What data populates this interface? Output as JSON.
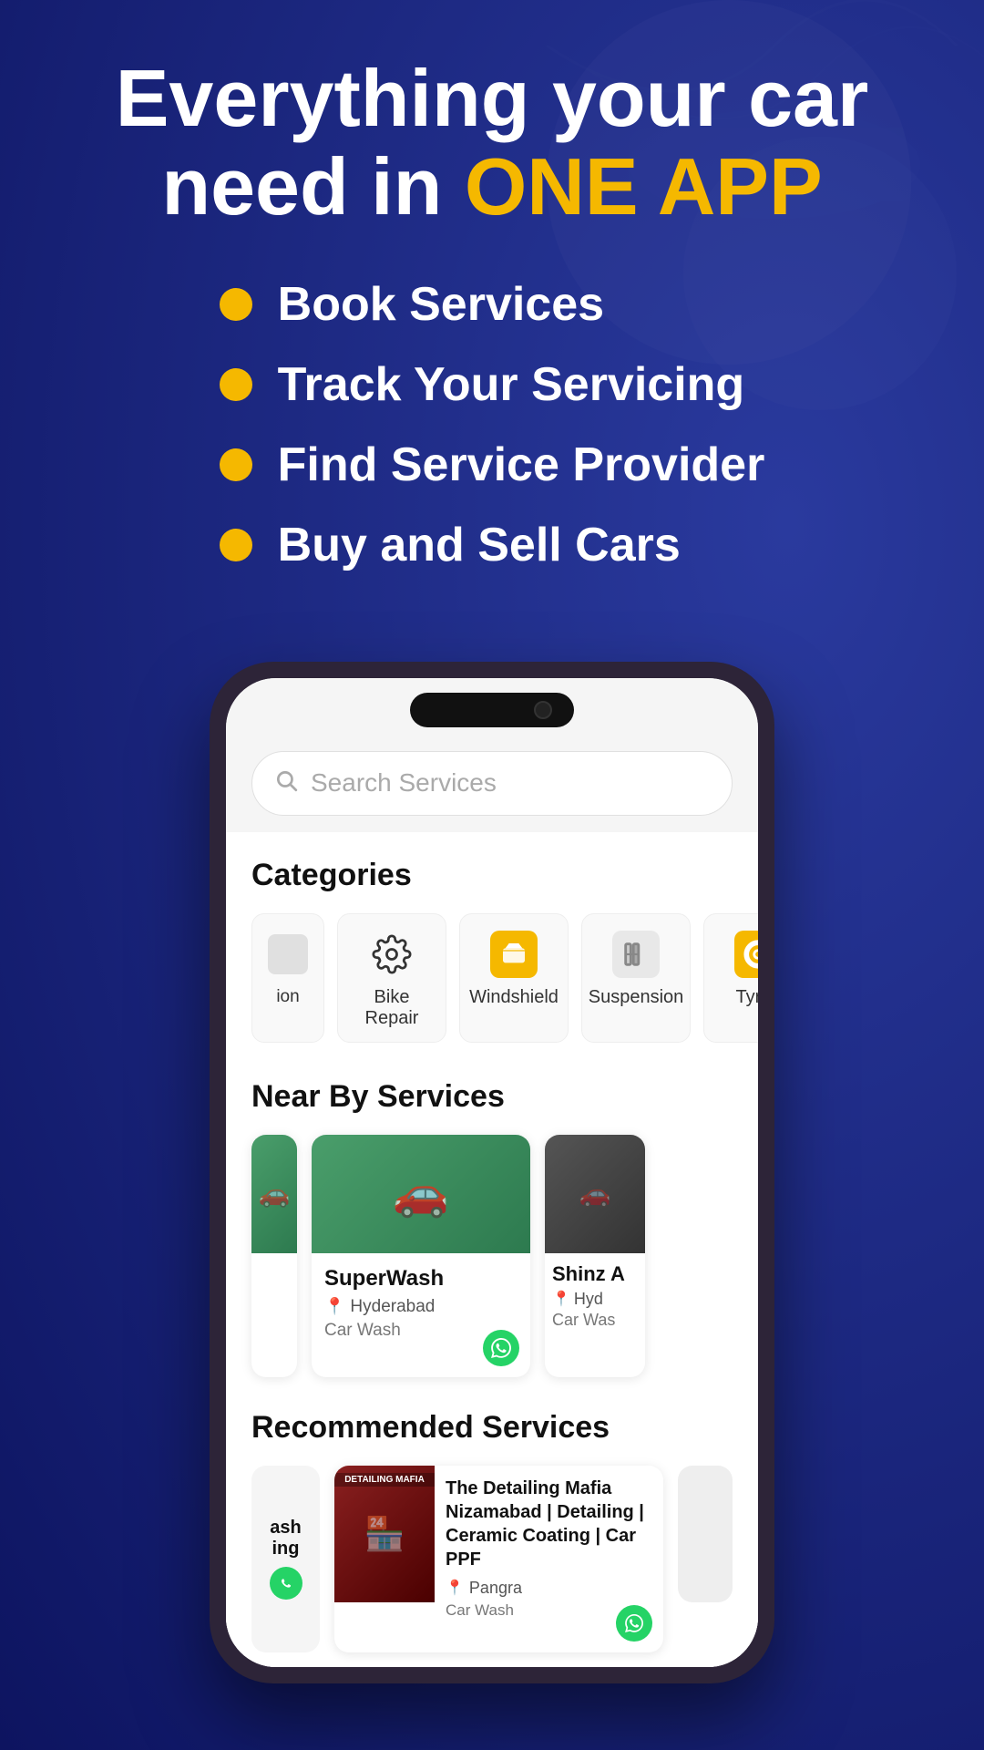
{
  "hero": {
    "title_line1": "Everything your car",
    "title_line2": "need in ",
    "title_highlight": "ONE APP",
    "features": [
      {
        "id": "book",
        "text": "Book Services"
      },
      {
        "id": "track",
        "text": "Track Your Servicing"
      },
      {
        "id": "find",
        "text": "Find Service Provider"
      },
      {
        "id": "buy",
        "text": "Buy and Sell Cars"
      }
    ]
  },
  "search": {
    "placeholder": "Search Services"
  },
  "categories": {
    "title": "Categories",
    "partial_label": "ion",
    "items": [
      {
        "id": "bike-repair",
        "label": "Bike Repair",
        "icon": "gear"
      },
      {
        "id": "windshield",
        "label": "Windshield",
        "icon": "windshield"
      },
      {
        "id": "suspension",
        "label": "Suspension",
        "icon": "suspension"
      },
      {
        "id": "tyres",
        "label": "Tyres",
        "icon": "tyre"
      }
    ]
  },
  "nearby": {
    "title": "Near By Services",
    "cards": [
      {
        "id": "superwash",
        "name": "SuperWash",
        "location": "Hyderabad",
        "type": "Car Wash",
        "has_whatsapp": true
      },
      {
        "id": "shinz",
        "name": "Shinz A",
        "location": "Hyd",
        "type": "Car Was",
        "has_whatsapp": false,
        "partial": true
      }
    ]
  },
  "recommended": {
    "title": "Recommended Services",
    "cards": [
      {
        "id": "partial-left",
        "partial_left": true,
        "name_partial": "ash\ning"
      },
      {
        "id": "detailing-mafia",
        "name": "The Detailing Mafia Nizamabad | Detailing | Ceramic Coating | Car PPF",
        "location": "Pangra",
        "type": "Car Wash",
        "has_whatsapp": true
      },
      {
        "id": "partial-right",
        "partial_right": true
      }
    ]
  },
  "colors": {
    "background": "#1a237e",
    "accent": "#f5b800",
    "white": "#ffffff",
    "card_bg": "#ffffff",
    "whatsapp": "#25d366"
  }
}
